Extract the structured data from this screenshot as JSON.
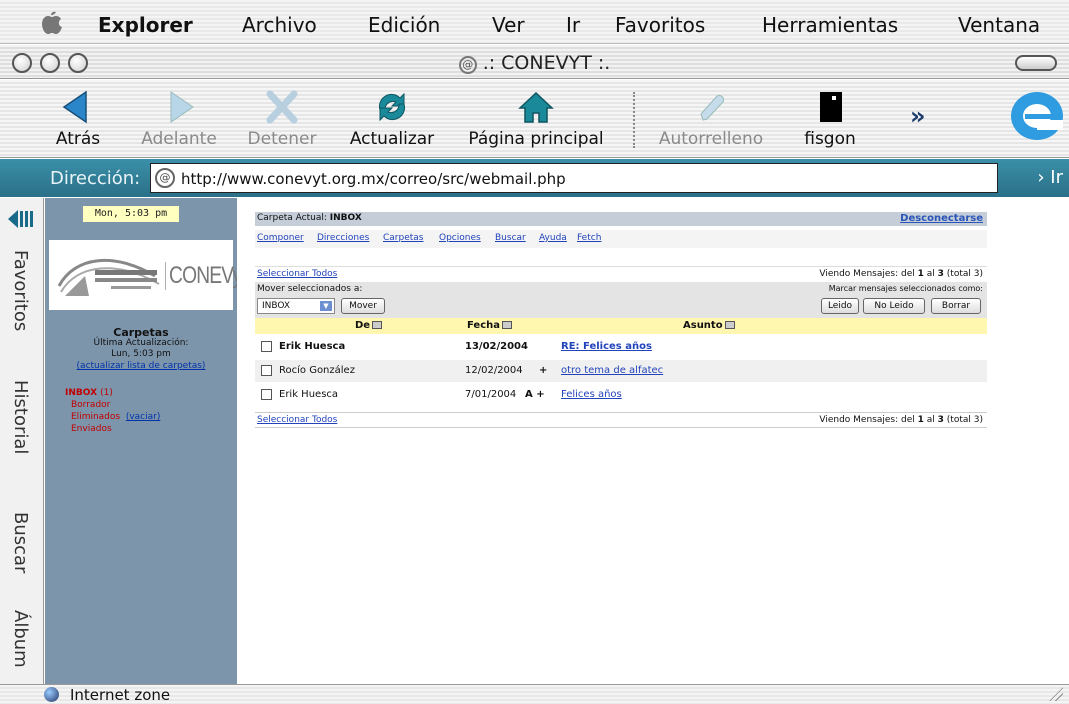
{
  "menubar": {
    "app_name": "Explorer",
    "items": [
      "Archivo",
      "Edición",
      "Ver",
      "Ir",
      "Favoritos",
      "Herramientas",
      "Ventana"
    ]
  },
  "window": {
    "title": ".: CONEVYT :."
  },
  "toolbar": {
    "back": "Atrás",
    "forward": "Adelante",
    "stop": "Detener",
    "refresh": "Actualizar",
    "home": "Página principal",
    "autofill": "Autorrelleno",
    "custom": "fisgon",
    "more": "»"
  },
  "address": {
    "label": "Dirección:",
    "url": "http://www.conevyt.org.mx/correo/src/webmail.php",
    "go": "› Ir"
  },
  "sidetabs": [
    "Favoritos",
    "Historial",
    "Buscar",
    "Álbum"
  ],
  "webmail": {
    "clock": "Mon, 5:03 pm",
    "logo_text": "CONEVyT",
    "folders_title": "Carpetas",
    "last_update_label": "Última Actualización:",
    "last_update_value": "Lun, 5:03 pm",
    "refresh_folders": "(actualizar lista de carpetas)",
    "folders": [
      {
        "name": "INBOX",
        "count": "(1)"
      },
      {
        "name": "Borrador"
      },
      {
        "name": "Eliminados",
        "action": "(vaciar)"
      },
      {
        "name": "Enviados"
      }
    ],
    "current_folder_label": "Carpeta Actual:",
    "current_folder": "INBOX",
    "signout": "Desconectarse",
    "nav": [
      "Componer",
      "Direcciones",
      "Carpetas",
      "Opciones",
      "Buscar",
      "Ayuda",
      "Fetch"
    ],
    "select_all": "Seleccionar Todos",
    "viewing_prefix": "Viendo Mensajes: del",
    "viewing_from": "1",
    "viewing_mid": "al",
    "viewing_to": "3",
    "viewing_total": "(total 3)",
    "move_label": "Mover seleccionados a:",
    "move_target": "INBOX",
    "move_button": "Mover",
    "mark_label": "Marcar mensajes seleccionados como:",
    "read_button": "Leido",
    "unread_button": "No Leido",
    "delete_button": "Borrar",
    "columns": {
      "from": "De",
      "date": "Fecha",
      "subject": "Asunto"
    },
    "messages": [
      {
        "from": "Erik Huesca",
        "date": "13/02/2004",
        "flag": "",
        "subject": "RE: Felices años"
      },
      {
        "from": "Rocío González",
        "date": "12/02/2004",
        "flag": "+",
        "subject": "otro tema de alfatec"
      },
      {
        "from": "Erik Huesca",
        "date": "7/01/2004",
        "flag": "A +",
        "subject": "Felices años"
      }
    ]
  },
  "status": {
    "zone": "Internet zone"
  },
  "colors": {
    "address_bar": "#2a7088",
    "left_pane": "#7d95ab",
    "link": "#2244bb",
    "folder_text": "#c00000",
    "column_header": "#fff6b0"
  }
}
